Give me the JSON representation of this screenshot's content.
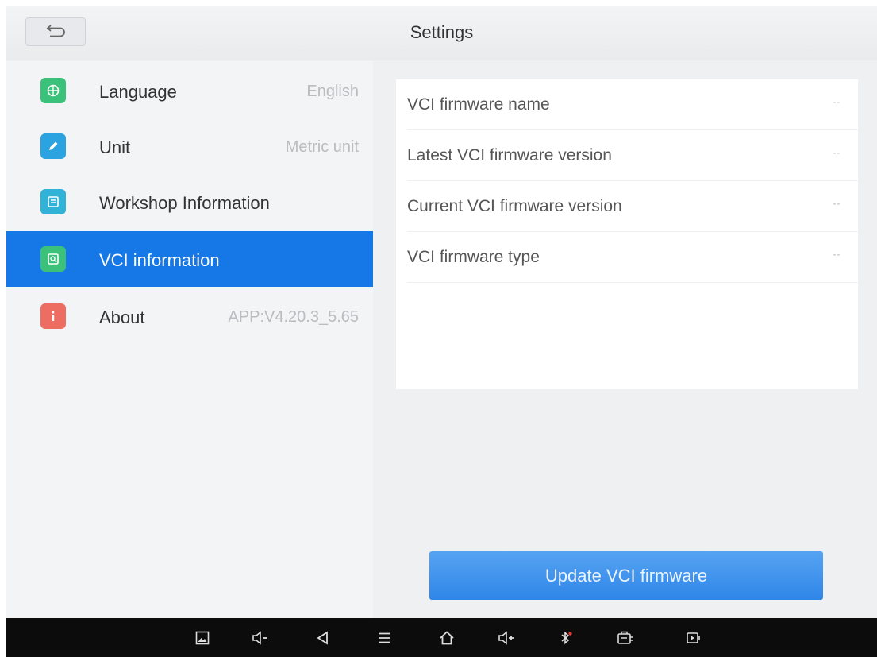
{
  "header": {
    "title": "Settings",
    "back_icon": "back-arrow-icon"
  },
  "sidebar": {
    "items": [
      {
        "label": "Language",
        "value": "English",
        "icon": "globe-icon",
        "color": "#3bc17a"
      },
      {
        "label": "Unit",
        "value": "Metric unit",
        "icon": "edit-icon",
        "color": "#2aa3e0"
      },
      {
        "label": "Workshop Information",
        "value": "",
        "icon": "workshop-icon",
        "color": "#31b3d8"
      },
      {
        "label": "VCI information",
        "value": "",
        "icon": "vci-icon",
        "color": "#3bc17a",
        "active": true
      },
      {
        "label": "About",
        "value": "APP:V4.20.3_5.65",
        "icon": "info-icon",
        "color": "#ee6d62"
      }
    ]
  },
  "vci": {
    "rows": [
      {
        "label": "VCI firmware name",
        "value": "--"
      },
      {
        "label": "Latest VCI firmware version",
        "value": "--"
      },
      {
        "label": "Current VCI firmware version",
        "value": "--"
      },
      {
        "label": "VCI firmware type",
        "value": "--"
      }
    ],
    "update_button": "Update VCI firmware"
  },
  "navbar": {
    "icons": [
      "screenshot-icon",
      "volume-down-icon",
      "back-icon",
      "menu-icon",
      "home-icon",
      "volume-up-icon",
      "bluetooth-icon",
      "vci-device-icon",
      "screen-record-icon"
    ]
  },
  "colors": {
    "accent": "#1677e6",
    "button": "#3a8ded",
    "navbar": "#0c0c0c"
  }
}
